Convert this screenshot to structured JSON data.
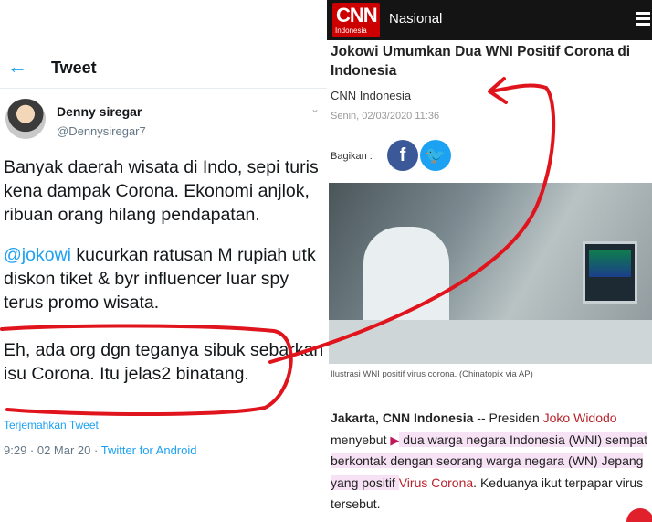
{
  "tweet": {
    "header": {
      "back_icon": "arrow-left-icon",
      "title": "Tweet"
    },
    "author": {
      "name": "Denny siregar",
      "handle": "@Dennysiregar7"
    },
    "paragraphs": {
      "p1": "Banyak daerah wisata di Indo, sepi turis kena dampak Corona. Ekonomi anjlok, ribuan orang hilang pendapatan.",
      "p2_mention": "@jokowi",
      "p2_rest": " kucurkan ratusan M rupiah utk diskon tiket  & byr influencer luar spy terus promo wisata.",
      "p3": "Eh, ada org dgn teganya sibuk sebarkan isu Corona. Itu jelas2 binatang."
    },
    "translate_label": "Terjemahkan Tweet",
    "meta": {
      "time": "9:29 · 02 Mar 20 · ",
      "via": "Twitter for Android"
    }
  },
  "article": {
    "logo": {
      "text": "CNN",
      "sub": "Indonesia"
    },
    "section": "Nasional",
    "headline": "Jokowi Umumkan Dua WNI Positif Corona di Indonesia",
    "source": "CNN Indonesia",
    "date": "Senin, 02/03/2020 11:36",
    "share_label": "Bagikan :",
    "share_icons": {
      "facebook": "f",
      "twitter": "🐦"
    },
    "caption": "Ilustrasi WNI positif virus corona. (Chinatopix via AP)",
    "body": {
      "lead": "Jakarta, CNN Indonesia",
      "sep": " -- Presiden ",
      "name": "Joko Widodo",
      "t1": " menyebut ",
      "hl": " dua warga negara Indonesia (WNI) sempat berkontak dengan seorang warga negara (WN) Jepang yang positif ",
      "virus": "Virus Corona",
      "t2": ". Keduanya ikut terpapar virus tersebut."
    }
  },
  "colors": {
    "annotation": "#e0141c",
    "cnn_red": "#cc0000",
    "twitter_blue": "#1da1f2"
  }
}
